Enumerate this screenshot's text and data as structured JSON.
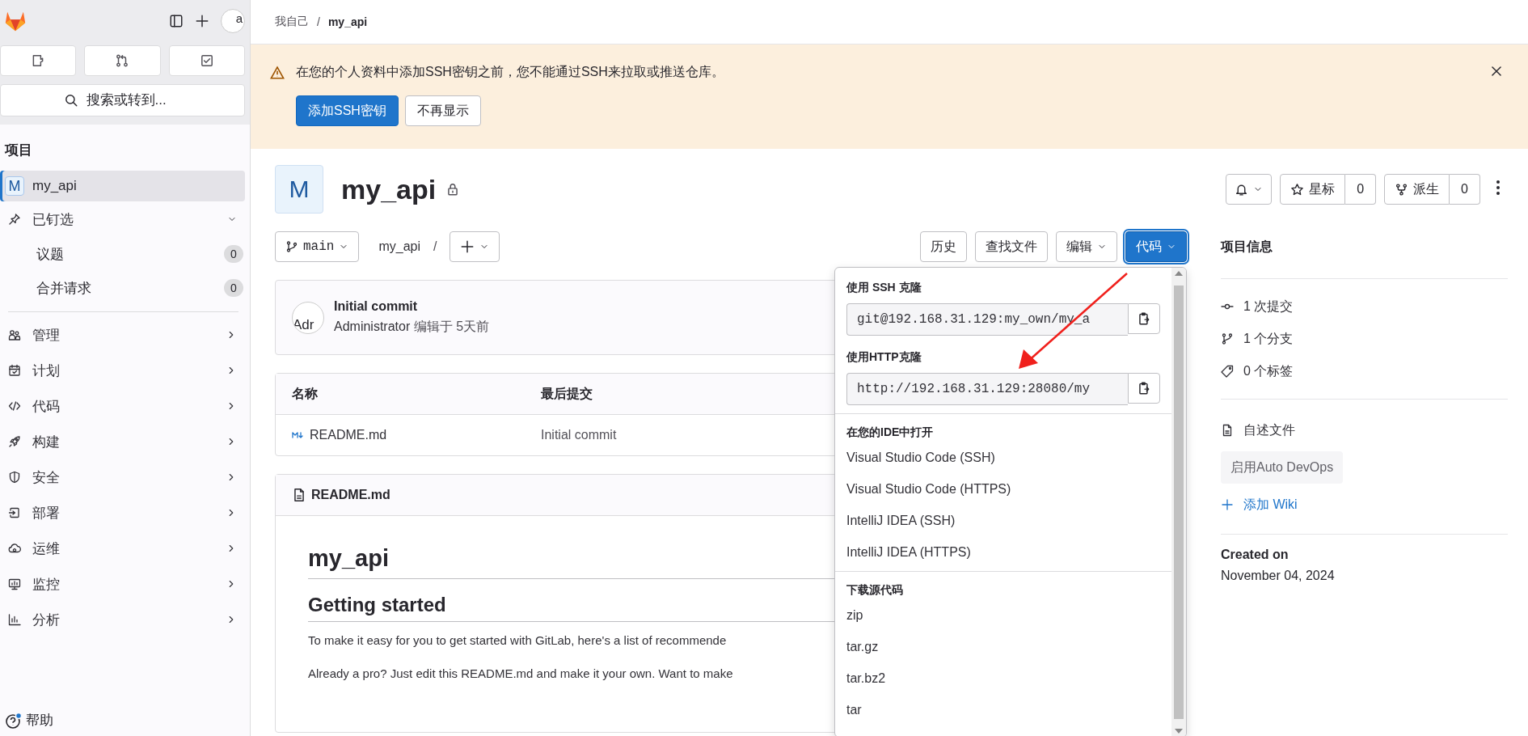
{
  "sidebar": {
    "avatar_text": "a",
    "search": {
      "placeholder": "搜索或转到..."
    },
    "section_title": "项目",
    "project": {
      "initial": "M",
      "name": "my_api",
      "selected": true
    },
    "pinned": {
      "label": "已钉选",
      "expanded": true,
      "children": [
        {
          "label": "议题",
          "count": "0"
        },
        {
          "label": "合并请求",
          "count": "0"
        }
      ]
    },
    "items": [
      {
        "label": "管理"
      },
      {
        "label": "计划"
      },
      {
        "label": "代码"
      },
      {
        "label": "构建"
      },
      {
        "label": "安全"
      },
      {
        "label": "部署"
      },
      {
        "label": "运维"
      },
      {
        "label": "监控"
      },
      {
        "label": "分析"
      }
    ],
    "help": "帮助"
  },
  "breadcrumb": {
    "items": [
      "我自己",
      "my_api"
    ],
    "separator": "/"
  },
  "banner": {
    "message": "在您的个人资料中添加SSH密钥之前，您不能通过SSH来拉取或推送仓库。",
    "primary": "添加SSH密钥",
    "secondary": "不再显示"
  },
  "project": {
    "initial": "M",
    "name": "my_api",
    "private": true,
    "star": {
      "label": "星标",
      "count": "0"
    },
    "fork": {
      "label": "派生",
      "count": "0"
    }
  },
  "toolbar": {
    "branch": "main",
    "path": "my_api",
    "separator": "/",
    "buttons": [
      "历史",
      "查找文件"
    ],
    "edit": "编辑",
    "code": {
      "label": "代码",
      "expanded": true
    }
  },
  "commit": {
    "avatar_text": "Adr",
    "title": "Initial commit",
    "author": "Administrator",
    "meta": "编辑于 5天前"
  },
  "files": {
    "columns": [
      "名称",
      "最后提交"
    ],
    "rows": [
      {
        "name": "README.md",
        "last_commit": "Initial commit"
      }
    ]
  },
  "readme": {
    "filename": "README.md",
    "heading": "my_api",
    "subheading": "Getting started",
    "paragraphs": [
      "To make it easy for you to get started with GitLab, here's a list of recommende",
      "Already a pro? Just edit this README.md and make it your own. Want to make"
    ]
  },
  "clone_dropdown": {
    "ssh": {
      "label": "使用 SSH 克隆",
      "value": "git@192.168.31.129:my_own/my_a"
    },
    "http": {
      "label": "使用HTTP克隆",
      "value": "http://192.168.31.129:28080/my"
    },
    "ide": {
      "title": "在您的IDE中打开",
      "items": [
        "Visual Studio Code (SSH)",
        "Visual Studio Code (HTTPS)",
        "IntelliJ IDEA (SSH)",
        "IntelliJ IDEA (HTTPS)"
      ]
    },
    "download": {
      "title": "下载源代码",
      "items": [
        "zip",
        "tar.gz",
        "tar.bz2",
        "tar"
      ]
    }
  },
  "project_info": {
    "title": "项目信息",
    "stats": [
      "1 次提交",
      "1 个分支",
      "0 个标签"
    ],
    "readme": "自述文件",
    "auto_devops": "启用Auto DevOps",
    "add_wiki": "添加 Wiki",
    "created_label": "Created on",
    "created_date": "November 04, 2024"
  }
}
